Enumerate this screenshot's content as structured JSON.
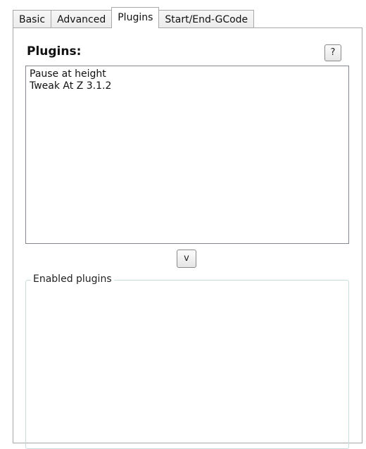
{
  "tabs": [
    {
      "label": "Basic",
      "active": false
    },
    {
      "label": "Advanced",
      "active": false
    },
    {
      "label": "Plugins",
      "active": true
    },
    {
      "label": "Start/End-GCode",
      "active": false
    }
  ],
  "plugins_section": {
    "title": "Plugins:",
    "help_button_label": "?",
    "available_plugins": [
      "Pause at height",
      "Tweak At Z 3.1.2"
    ],
    "move_down_button_label": "v"
  },
  "enabled_plugins": {
    "legend": "Enabled plugins",
    "items": []
  }
}
